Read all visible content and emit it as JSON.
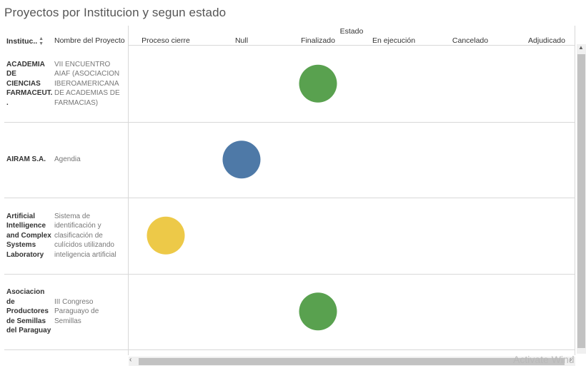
{
  "title": "Proyectos por Institucion y segun estado",
  "headers": {
    "institucion": "Instituc..",
    "proyecto": "Nombre del Proyecto",
    "estado": "Estado"
  },
  "icons": {
    "sort": "sort-icon",
    "scroll_up": "scroll-up-arrow-icon",
    "scroll_left": "scroll-left-arrow-icon",
    "scroll_right": "scroll-right-arrow-icon"
  },
  "watermark": "Activate Wind",
  "chart_data": {
    "type": "scatter",
    "columns": [
      "Proceso cierre",
      "Null",
      "Finalizado",
      "En ejecución",
      "Cancelado",
      "Adjudicado"
    ],
    "colors": {
      "Finalizado": "#59a14f",
      "Null": "#4e79a7",
      "Proceso cierre": "#edc948"
    },
    "rows": [
      {
        "institucion": "ACADEMIA DE CIENCIAS FARMACEUT. .",
        "proyecto": "VII ENCUENTRO AIAF (ASOCIACION IBEROAMERICANA DE ACADEMIAS DE FARMACIAS)",
        "estado": "Finalizado"
      },
      {
        "institucion": "AIRAM S.A.",
        "proyecto": "Agendia",
        "estado": "Null"
      },
      {
        "institucion": "Artificial Intelligence and Complex Systems Laboratory",
        "proyecto": "Sistema de identificación y clasificación de culícidos utilizando inteligencia artificial",
        "estado": "Proceso cierre"
      },
      {
        "institucion": "Asociacion de Productores de Semillas del Paraguay",
        "proyecto": "III Congreso Paraguayo de Semillas",
        "estado": "Finalizado"
      }
    ]
  }
}
